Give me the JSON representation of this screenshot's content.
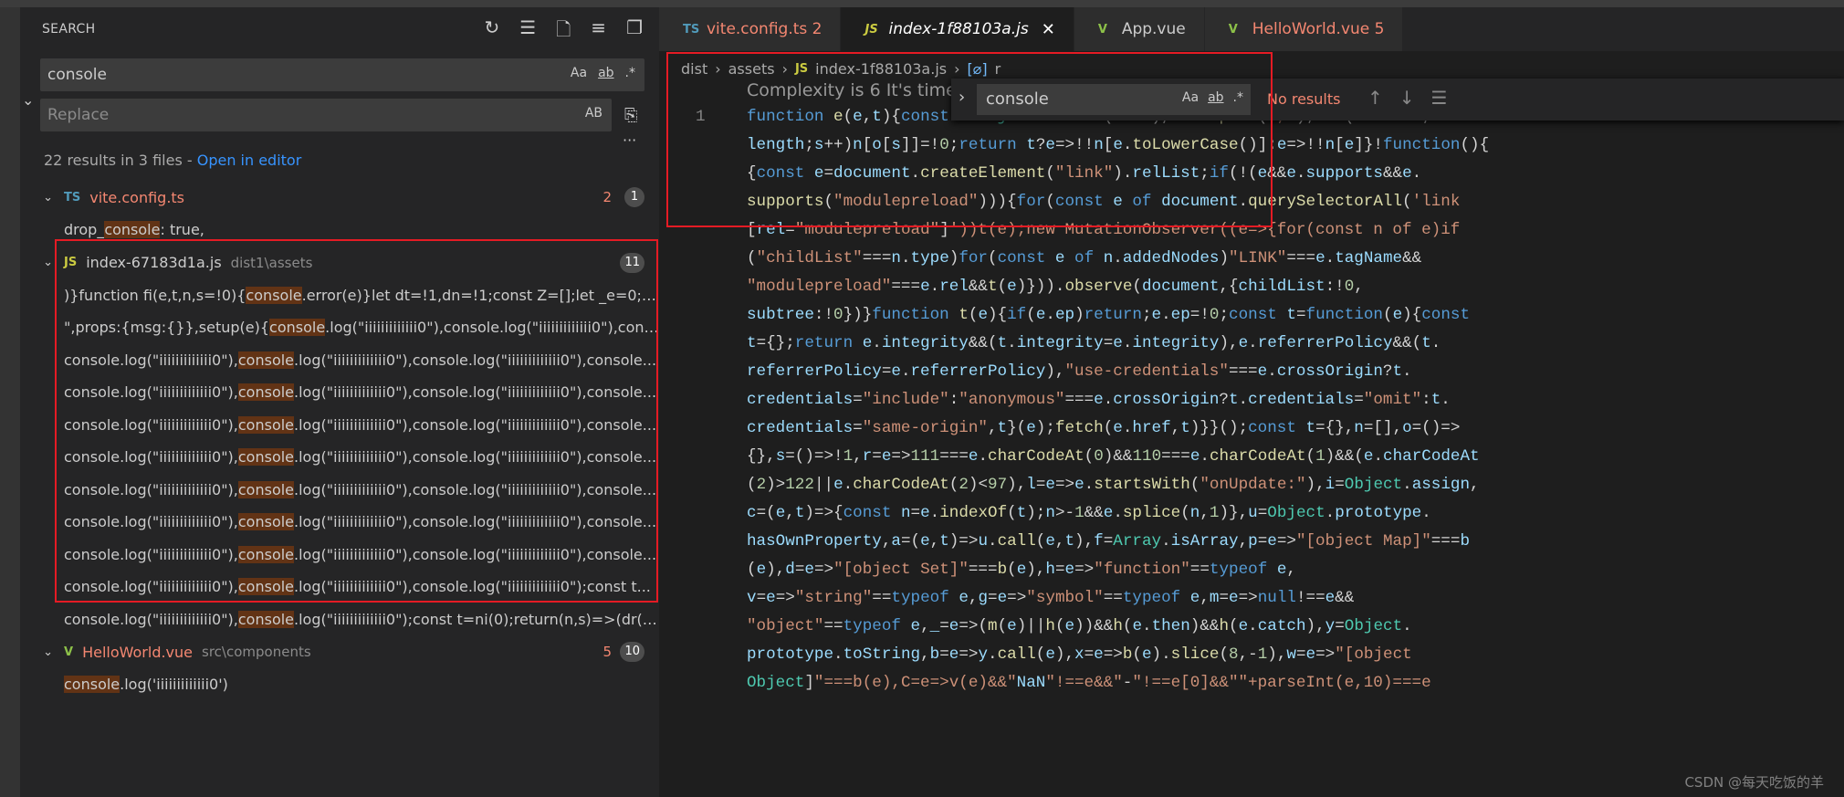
{
  "sidebar": {
    "title": "SEARCH",
    "actions": [
      {
        "name": "refresh-icon",
        "glyph": "↻"
      },
      {
        "name": "clear-results-icon",
        "glyph": "☰"
      },
      {
        "name": "new-search-editor-icon",
        "glyph": "🗋"
      },
      {
        "name": "collapse-icon",
        "glyph": "≡"
      },
      {
        "name": "view-as-tree-icon",
        "glyph": "❐"
      }
    ],
    "search_value": "console",
    "replace_placeholder": "Replace",
    "opt_case": "Aa",
    "opt_word": "ab",
    "opt_regex": ".*",
    "opt_preserve": "AB",
    "more": "···",
    "summary": "22 results in 3 files - ",
    "open_in_editor": "Open in editor",
    "files": [
      {
        "icon": "TS",
        "icon_color": "#519aba",
        "name": "vite.config.ts",
        "name_color": "#f48771",
        "path": "",
        "count": "2",
        "badge": "1",
        "matches": [
          {
            "pre": "drop_",
            "hit": "console",
            "post": ": true,"
          }
        ]
      },
      {
        "icon": "JS",
        "icon_color": "#cbcb41",
        "name": "index-67183d1a.js",
        "name_color": "#cccccc",
        "path": "dist1\\assets",
        "count": "",
        "badge": "11",
        "matches": [
          {
            "pre": ")}function fi(e,t,n,s=!0){",
            "hit": "console",
            "post": ".error(e)}let dt=!1,dn=!1;const Z=[];let _e=0;const..."
          },
          {
            "pre": "\",props:{msg:{}},setup(e){",
            "hit": "console",
            "post": ".log(\"iiiiiiiiiiiii0\"),console.log(\"iiiiiiiiiiiii0\"),consol..."
          },
          {
            "pre": "console.log(\"iiiiiiiiiiiii0\"),",
            "hit": "console",
            "post": ".log(\"iiiiiiiiiiiii0\"),console.log(\"iiiiiiiiiiiii0\"),console..."
          },
          {
            "pre": "console.log(\"iiiiiiiiiiiii0\"),",
            "hit": "console",
            "post": ".log(\"iiiiiiiiiiiii0\"),console.log(\"iiiiiiiiiiiii0\"),console..."
          },
          {
            "pre": "console.log(\"iiiiiiiiiiiii0\"),",
            "hit": "console",
            "post": ".log(\"iiiiiiiiiiiii0\"),console.log(\"iiiiiiiiiiiii0\"),console..."
          },
          {
            "pre": "console.log(\"iiiiiiiiiiiii0\"),",
            "hit": "console",
            "post": ".log(\"iiiiiiiiiiiii0\"),console.log(\"iiiiiiiiiiiii0\"),console..."
          },
          {
            "pre": "console.log(\"iiiiiiiiiiiii0\"),",
            "hit": "console",
            "post": ".log(\"iiiiiiiiiiiii0\"),console.log(\"iiiiiiiiiiiii0\"),console..."
          },
          {
            "pre": "console.log(\"iiiiiiiiiiiii0\"),",
            "hit": "console",
            "post": ".log(\"iiiiiiiiiiiii0\"),console.log(\"iiiiiiiiiiiii0\"),console..."
          },
          {
            "pre": "console.log(\"iiiiiiiiiiiii0\"),",
            "hit": "console",
            "post": ".log(\"iiiiiiiiiiiii0\"),console.log(\"iiiiiiiiiiiii0\"),console..."
          },
          {
            "pre": "console.log(\"iiiiiiiiiiiii0\"),",
            "hit": "console",
            "post": ".log(\"iiiiiiiiiiiii0\"),console.log(\"iiiiiiiiiiiii0\");const t..."
          },
          {
            "pre": "console.log(\"iiiiiiiiiiiii0\"),",
            "hit": "console",
            "post": ".log(\"iiiiiiiiiiiii0\");const t=ni(0);return(n,s)=>(dr(),..."
          }
        ]
      },
      {
        "icon": "V",
        "icon_color": "#8dc149",
        "name": "HelloWorld.vue",
        "name_color": "#f48771",
        "path": "src\\components",
        "count": "5",
        "badge": "10",
        "matches": [
          {
            "pre": "",
            "hit": "console",
            "post": ".log('iiiiiiiiiiiii0')"
          }
        ]
      }
    ]
  },
  "tabs": [
    {
      "icon": "TS",
      "icon_color": "#519aba",
      "label": "vite.config.ts 2",
      "color": "#f48771",
      "active": false
    },
    {
      "icon": "JS",
      "icon_color": "#cbcb41",
      "label": "index-1f88103a.js",
      "color": "#ffffff",
      "active": true,
      "close": "✕"
    },
    {
      "icon": "V",
      "icon_color": "#8dc149",
      "label": "App.vue",
      "color": "#cccccc",
      "active": false
    },
    {
      "icon": "V",
      "icon_color": "#8dc149",
      "label": "HelloWorld.vue 5",
      "color": "#f48771",
      "active": false
    }
  ],
  "breadcrumb": {
    "parts": [
      "dist",
      "assets"
    ],
    "file_icon": "JS",
    "file": "index-1f88103a.js",
    "symbol_icon": "[⌀]",
    "symbol": "r"
  },
  "editor": {
    "codelens": "Complexity is 6 It's time to do something...",
    "line_number": "1",
    "lines": [
      "function e(e,t){const n=Object.create(null),o=e.split(\",\");for(let s=0;s<o.",
      "length;s++)n[o[s]]=!0;return t?e=>!!n[e.toLowerCase()]:e=>!!n[e]}!function(){",
      "{const e=document.createElement(\"link\").relList;if(!(e&&e.supports&&e.",
      "supports(\"modulepreload\"))){for(const e of document.querySelectorAll('link",
      "[rel=\"modulepreload\"]'))t(e);new MutationObserver((e=>{for(const n of e)if",
      "(\"childList\"===n.type)for(const e of n.addedNodes)\"LINK\"===e.tagName&&",
      "\"modulepreload\"===e.rel&&t(e)})).observe(document,{childList:!0,",
      "subtree:!0})}function t(e){if(e.ep)return;e.ep=!0;const t=function(e){const",
      "t={};return e.integrity&&(t.integrity=e.integrity),e.referrerPolicy&&(t.",
      "referrerPolicy=e.referrerPolicy),\"use-credentials\"===e.crossOrigin?t.",
      "credentials=\"include\":\"anonymous\"===e.crossOrigin?t.credentials=\"omit\":t.",
      "credentials=\"same-origin\",t}(e);fetch(e.href,t)}}();const t={},n=[],o=()=>",
      "{},s=()=>!1,r=e=>111===e.charCodeAt(0)&&110===e.charCodeAt(1)&&(e.charCodeAt",
      "(2)>122||e.charCodeAt(2)<97),l=e=>e.startsWith(\"onUpdate:\"),i=Object.assign,",
      "c=(e,t)=>{const n=e.indexOf(t);n>-1&&e.splice(n,1)},u=Object.prototype.",
      "hasOwnProperty,a=(e,t)=>u.call(e,t),f=Array.isArray,p=e=>\"[object Map]\"===b",
      "(e),d=e=>\"[object Set]\"===b(e),h=e=>\"function\"==typeof e,",
      "v=e=>\"string\"==typeof e,g=e=>\"symbol\"==typeof e,m=e=>null!==e&&",
      "\"object\"==typeof e,_=e=>(m(e)||h(e))&&h(e.then)&&h(e.catch),y=Object.",
      "prototype.toString,b=e=>y.call(e),x=e=>b(e).slice(8,-1),w=e=>\"[object",
      "Object]\"===b(e),C=e=>v(e)&&\"NaN\"!==e&&\"-\"!==e[0]&&\"\"+parseInt(e,10)===e"
    ]
  },
  "find": {
    "value": "console",
    "opt_case": "Aa",
    "opt_word": "ab",
    "opt_regex": ".*",
    "status": "No results",
    "prev": "↑",
    "next": "↓",
    "more": "☰"
  },
  "watermark": "CSDN @每天吃饭的羊"
}
